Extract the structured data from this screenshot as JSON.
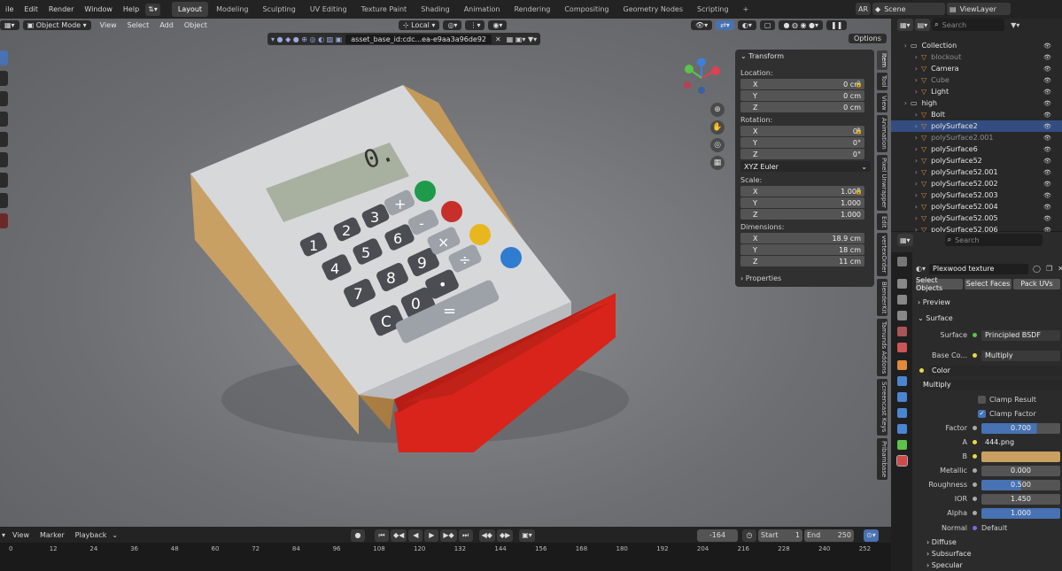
{
  "topbar": {
    "menus": [
      "ile",
      "Edit",
      "Render",
      "Window",
      "Help"
    ],
    "workspaces": [
      "Layout",
      "Modeling",
      "Sculpting",
      "UV Editing",
      "Texture Paint",
      "Shading",
      "Animation",
      "Rendering",
      "Compositing",
      "Geometry Nodes",
      "Scripting"
    ],
    "active_workspace": "Layout",
    "add_tab": "+",
    "engine_label": "AR",
    "scene": "Scene",
    "view_layer": "ViewLayer"
  },
  "viewport": {
    "mode": "Object Mode",
    "menus": [
      "View",
      "Select",
      "Add",
      "Object"
    ],
    "transform_orientation": "Local",
    "asset_id": "asset_base_id:cdc...ea-e9aa3a96de92",
    "options_label": "Options"
  },
  "npanel": {
    "transform_title": "Transform",
    "location_label": "Location:",
    "location": [
      {
        "axis": "X",
        "value": "0 cm"
      },
      {
        "axis": "Y",
        "value": "0 cm"
      },
      {
        "axis": "Z",
        "value": "0 cm"
      }
    ],
    "rotation_label": "Rotation:",
    "rotation": [
      {
        "axis": "X",
        "value": "0°"
      },
      {
        "axis": "Y",
        "value": "0°"
      },
      {
        "axis": "Z",
        "value": "0°"
      }
    ],
    "rotation_mode": "XYZ Euler",
    "scale_label": "Scale:",
    "scale": [
      {
        "axis": "X",
        "value": "1.000"
      },
      {
        "axis": "Y",
        "value": "1.000"
      },
      {
        "axis": "Z",
        "value": "1.000"
      }
    ],
    "dimensions_label": "Dimensions:",
    "dimensions": [
      {
        "axis": "X",
        "value": "18.9 cm"
      },
      {
        "axis": "Y",
        "value": "18 cm"
      },
      {
        "axis": "Z",
        "value": "11 cm"
      }
    ],
    "properties_title": "Properties"
  },
  "side_tabs": [
    "Item",
    "Tool",
    "View",
    "Animation",
    "Pixel Unwrapper",
    "Edit",
    "vertexOrder",
    "BlenderKit",
    "Tamunds Addons",
    "Screencast Keys",
    "Pribambase"
  ],
  "timeline": {
    "menus": [
      "View",
      "Marker",
      "Playback"
    ],
    "current_frame": "-164",
    "start_label": "Start",
    "start": "1",
    "end_label": "End",
    "end": "250",
    "ticks": [
      "0",
      "12",
      "24",
      "36",
      "48",
      "60",
      "72",
      "84",
      "96",
      "108",
      "120",
      "132",
      "144",
      "156",
      "168",
      "180",
      "192",
      "204",
      "216",
      "228",
      "240",
      "252"
    ]
  },
  "outliner": {
    "search_placeholder": "Search",
    "rows": [
      {
        "name": "Collection",
        "indent": 1,
        "dim": false,
        "selected": false,
        "color": "#d9d9d9"
      },
      {
        "name": "blockout",
        "indent": 2,
        "dim": true,
        "selected": false,
        "color": "#e08a3a"
      },
      {
        "name": "Camera",
        "indent": 2,
        "dim": false,
        "selected": false,
        "color": "#e08a3a"
      },
      {
        "name": "Cube",
        "indent": 2,
        "dim": true,
        "selected": false,
        "color": "#e08a3a"
      },
      {
        "name": "Light",
        "indent": 2,
        "dim": false,
        "selected": false,
        "color": "#e08a3a"
      },
      {
        "name": "high",
        "indent": 1,
        "dim": false,
        "selected": false,
        "color": "#d9d9d9"
      },
      {
        "name": "Bolt",
        "indent": 2,
        "dim": false,
        "selected": false,
        "color": "#e08a3a"
      },
      {
        "name": "polySurface2",
        "indent": 2,
        "dim": false,
        "selected": true,
        "color": "#e08a3a"
      },
      {
        "name": "polySurface2.001",
        "indent": 2,
        "dim": true,
        "selected": false,
        "color": "#e08a3a"
      },
      {
        "name": "polySurface6",
        "indent": 2,
        "dim": false,
        "selected": false,
        "color": "#e08a3a"
      },
      {
        "name": "polySurface52",
        "indent": 2,
        "dim": false,
        "selected": false,
        "color": "#e08a3a"
      },
      {
        "name": "polySurface52.001",
        "indent": 2,
        "dim": false,
        "selected": false,
        "color": "#e08a3a"
      },
      {
        "name": "polySurface52.002",
        "indent": 2,
        "dim": false,
        "selected": false,
        "color": "#e08a3a"
      },
      {
        "name": "polySurface52.003",
        "indent": 2,
        "dim": false,
        "selected": false,
        "color": "#e08a3a"
      },
      {
        "name": "polySurface52.004",
        "indent": 2,
        "dim": false,
        "selected": false,
        "color": "#e08a3a"
      },
      {
        "name": "polySurface52.005",
        "indent": 2,
        "dim": false,
        "selected": false,
        "color": "#e08a3a"
      },
      {
        "name": "polySurface52.006",
        "indent": 2,
        "dim": false,
        "selected": false,
        "color": "#e08a3a"
      }
    ]
  },
  "properties": {
    "search_placeholder": "Search",
    "material_name": "Plexwood texture",
    "buttons": [
      "Select Objects",
      "Select Faces",
      "Pack UVs"
    ],
    "preview_label": "Preview",
    "surface_section": "Surface",
    "surface_label": "Surface",
    "surface_value": "Principled BSDF",
    "base_color_label": "Base Co...",
    "base_color_value": "Multiply",
    "color_label": "Color",
    "blend_mode": "Multiply",
    "clamp_result": "Clamp Result",
    "clamp_factor": "Clamp Factor",
    "factor_label": "Factor",
    "factor_value": "0.700",
    "factor_fill": 0.7,
    "a_label": "A",
    "a_value": "444.png",
    "b_label": "B",
    "b_color": "#c9a060",
    "metallic_label": "Metallic",
    "metallic_value": "0.000",
    "roughness_label": "Roughness",
    "roughness_value": "0.500",
    "roughness_fill": 0.5,
    "ior_label": "IOR",
    "ior_value": "1.450",
    "alpha_label": "Alpha",
    "alpha_value": "1.000",
    "alpha_fill": 1.0,
    "normal_label": "Normal",
    "normal_value": "Default",
    "diffuse_label": "Diffuse",
    "subsurface_label": "Subsurface",
    "specular_label": "Specular"
  },
  "calculator": {
    "display": "0.",
    "keys": [
      "1",
      "2",
      "3",
      "4",
      "5",
      "6",
      "7",
      "8",
      "9",
      "0",
      "C",
      "+",
      "-",
      "×",
      "÷",
      "•",
      "="
    ]
  },
  "colors": {
    "accent": "#4772b3",
    "selected_row": "#334d80",
    "drawer": "#e0261c",
    "wood": "#c49a5a"
  }
}
